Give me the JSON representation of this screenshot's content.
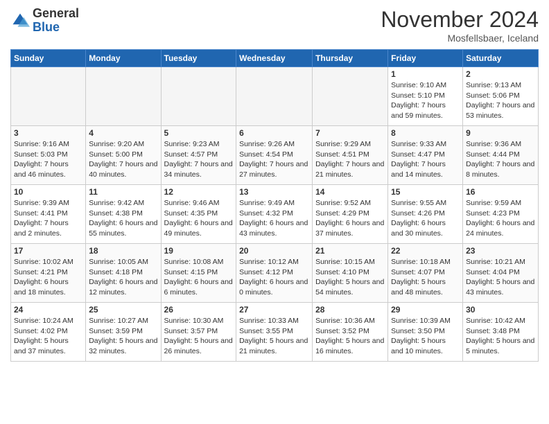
{
  "header": {
    "logo_line1": "General",
    "logo_line2": "Blue",
    "month": "November 2024",
    "location": "Mosfellsbaer, Iceland"
  },
  "weekdays": [
    "Sunday",
    "Monday",
    "Tuesday",
    "Wednesday",
    "Thursday",
    "Friday",
    "Saturday"
  ],
  "weeks": [
    [
      {
        "day": "",
        "info": ""
      },
      {
        "day": "",
        "info": ""
      },
      {
        "day": "",
        "info": ""
      },
      {
        "day": "",
        "info": ""
      },
      {
        "day": "",
        "info": ""
      },
      {
        "day": "1",
        "info": "Sunrise: 9:10 AM\nSunset: 5:10 PM\nDaylight: 7 hours and 59 minutes."
      },
      {
        "day": "2",
        "info": "Sunrise: 9:13 AM\nSunset: 5:06 PM\nDaylight: 7 hours and 53 minutes."
      }
    ],
    [
      {
        "day": "3",
        "info": "Sunrise: 9:16 AM\nSunset: 5:03 PM\nDaylight: 7 hours and 46 minutes."
      },
      {
        "day": "4",
        "info": "Sunrise: 9:20 AM\nSunset: 5:00 PM\nDaylight: 7 hours and 40 minutes."
      },
      {
        "day": "5",
        "info": "Sunrise: 9:23 AM\nSunset: 4:57 PM\nDaylight: 7 hours and 34 minutes."
      },
      {
        "day": "6",
        "info": "Sunrise: 9:26 AM\nSunset: 4:54 PM\nDaylight: 7 hours and 27 minutes."
      },
      {
        "day": "7",
        "info": "Sunrise: 9:29 AM\nSunset: 4:51 PM\nDaylight: 7 hours and 21 minutes."
      },
      {
        "day": "8",
        "info": "Sunrise: 9:33 AM\nSunset: 4:47 PM\nDaylight: 7 hours and 14 minutes."
      },
      {
        "day": "9",
        "info": "Sunrise: 9:36 AM\nSunset: 4:44 PM\nDaylight: 7 hours and 8 minutes."
      }
    ],
    [
      {
        "day": "10",
        "info": "Sunrise: 9:39 AM\nSunset: 4:41 PM\nDaylight: 7 hours and 2 minutes."
      },
      {
        "day": "11",
        "info": "Sunrise: 9:42 AM\nSunset: 4:38 PM\nDaylight: 6 hours and 55 minutes."
      },
      {
        "day": "12",
        "info": "Sunrise: 9:46 AM\nSunset: 4:35 PM\nDaylight: 6 hours and 49 minutes."
      },
      {
        "day": "13",
        "info": "Sunrise: 9:49 AM\nSunset: 4:32 PM\nDaylight: 6 hours and 43 minutes."
      },
      {
        "day": "14",
        "info": "Sunrise: 9:52 AM\nSunset: 4:29 PM\nDaylight: 6 hours and 37 minutes."
      },
      {
        "day": "15",
        "info": "Sunrise: 9:55 AM\nSunset: 4:26 PM\nDaylight: 6 hours and 30 minutes."
      },
      {
        "day": "16",
        "info": "Sunrise: 9:59 AM\nSunset: 4:23 PM\nDaylight: 6 hours and 24 minutes."
      }
    ],
    [
      {
        "day": "17",
        "info": "Sunrise: 10:02 AM\nSunset: 4:21 PM\nDaylight: 6 hours and 18 minutes."
      },
      {
        "day": "18",
        "info": "Sunrise: 10:05 AM\nSunset: 4:18 PM\nDaylight: 6 hours and 12 minutes."
      },
      {
        "day": "19",
        "info": "Sunrise: 10:08 AM\nSunset: 4:15 PM\nDaylight: 6 hours and 6 minutes."
      },
      {
        "day": "20",
        "info": "Sunrise: 10:12 AM\nSunset: 4:12 PM\nDaylight: 6 hours and 0 minutes."
      },
      {
        "day": "21",
        "info": "Sunrise: 10:15 AM\nSunset: 4:10 PM\nDaylight: 5 hours and 54 minutes."
      },
      {
        "day": "22",
        "info": "Sunrise: 10:18 AM\nSunset: 4:07 PM\nDaylight: 5 hours and 48 minutes."
      },
      {
        "day": "23",
        "info": "Sunrise: 10:21 AM\nSunset: 4:04 PM\nDaylight: 5 hours and 43 minutes."
      }
    ],
    [
      {
        "day": "24",
        "info": "Sunrise: 10:24 AM\nSunset: 4:02 PM\nDaylight: 5 hours and 37 minutes."
      },
      {
        "day": "25",
        "info": "Sunrise: 10:27 AM\nSunset: 3:59 PM\nDaylight: 5 hours and 32 minutes."
      },
      {
        "day": "26",
        "info": "Sunrise: 10:30 AM\nSunset: 3:57 PM\nDaylight: 5 hours and 26 minutes."
      },
      {
        "day": "27",
        "info": "Sunrise: 10:33 AM\nSunset: 3:55 PM\nDaylight: 5 hours and 21 minutes."
      },
      {
        "day": "28",
        "info": "Sunrise: 10:36 AM\nSunset: 3:52 PM\nDaylight: 5 hours and 16 minutes."
      },
      {
        "day": "29",
        "info": "Sunrise: 10:39 AM\nSunset: 3:50 PM\nDaylight: 5 hours and 10 minutes."
      },
      {
        "day": "30",
        "info": "Sunrise: 10:42 AM\nSunset: 3:48 PM\nDaylight: 5 hours and 5 minutes."
      }
    ]
  ]
}
